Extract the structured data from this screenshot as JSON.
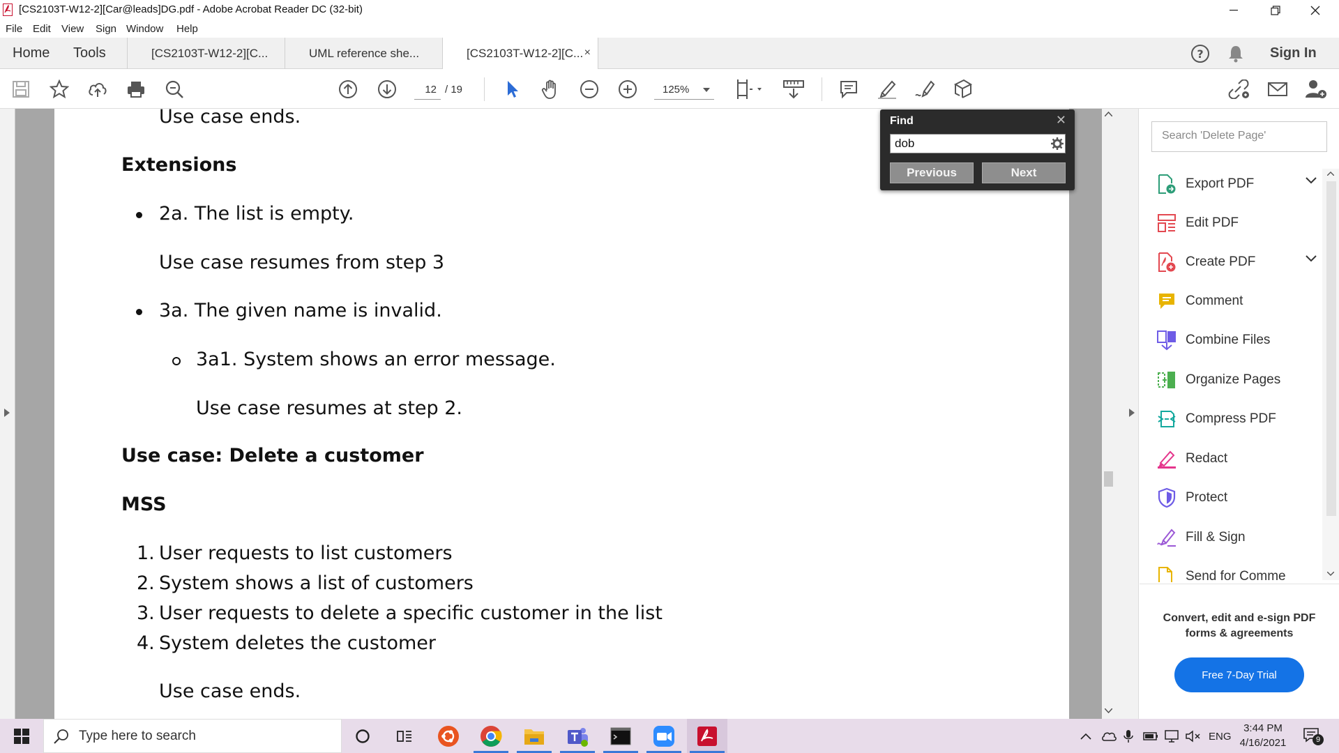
{
  "window": {
    "title": "[CS2103T-W12-2][Car@leads]DG.pdf - Adobe Acrobat Reader DC (32-bit)"
  },
  "menu": [
    "File",
    "Edit",
    "View",
    "Sign",
    "Window",
    "Help"
  ],
  "tabs": {
    "home": "Home",
    "tools": "Tools",
    "documents": [
      {
        "label": "[CS2103T-W12-2][C..."
      },
      {
        "label": "UML reference she..."
      },
      {
        "label": "[CS2103T-W12-2][C..."
      }
    ],
    "close_glyph": "×",
    "sign_in": "Sign In"
  },
  "toolbar": {
    "page_current": "12",
    "page_total": "/ 19",
    "zoom": "125%"
  },
  "document": {
    "lines": {
      "use_case_ends_top": "Use case ends.",
      "extensions_heading": "Extensions",
      "ext_2a": "2a. The list is empty.",
      "resume_step3": "Use case resumes from step 3",
      "ext_3a": "3a. The given name is invalid.",
      "ext_3a1": "3a1. System shows an error message.",
      "resume_step2": "Use case resumes at step 2.",
      "use_case_heading": "Use case: Delete a customer",
      "mss_heading": "MSS",
      "use_case_ends_bottom": "Use case ends."
    },
    "mss_steps": [
      {
        "num": "1.",
        "text": "User requests to list customers"
      },
      {
        "num": "2.",
        "text": "System shows a list of customers"
      },
      {
        "num": "3.",
        "text": "User requests to delete a specific customer in the list"
      },
      {
        "num": "4.",
        "text": "System deletes the customer"
      }
    ]
  },
  "find": {
    "title": "Find",
    "query": "dob",
    "previous": "Previous",
    "next": "Next"
  },
  "right_pane": {
    "search_placeholder": "Search 'Delete Page'",
    "tools": [
      {
        "label": "Export PDF",
        "icon": "export-pdf-icon",
        "color": "#2d9d78",
        "has_chevron": true
      },
      {
        "label": "Edit PDF",
        "icon": "edit-pdf-icon",
        "color": "#e34850",
        "has_chevron": false
      },
      {
        "label": "Create PDF",
        "icon": "create-pdf-icon",
        "color": "#e34850",
        "has_chevron": true
      },
      {
        "label": "Comment",
        "icon": "comment-icon",
        "color": "#e8b400",
        "has_chevron": false
      },
      {
        "label": "Combine Files",
        "icon": "combine-files-icon",
        "color": "#6e5ce6",
        "has_chevron": false
      },
      {
        "label": "Organize Pages",
        "icon": "organize-pages-icon",
        "color": "#4caf50",
        "has_chevron": false
      },
      {
        "label": "Compress PDF",
        "icon": "compress-pdf-icon",
        "color": "#13a89e",
        "has_chevron": false
      },
      {
        "label": "Redact",
        "icon": "redact-icon",
        "color": "#e5358c",
        "has_chevron": false
      },
      {
        "label": "Protect",
        "icon": "protect-icon",
        "color": "#6e5ce6",
        "has_chevron": false
      },
      {
        "label": "Fill & Sign",
        "icon": "fill-sign-icon",
        "color": "#9b59d6",
        "has_chevron": false
      },
      {
        "label": "Send for Comme",
        "icon": "send-for-comment-icon",
        "color": "#e8b400",
        "has_chevron": false
      }
    ],
    "promo_text": "Convert, edit and e-sign PDF forms & agreements",
    "promo_button": "Free 7-Day Trial"
  },
  "taskbar": {
    "search_placeholder": "Type here to search",
    "language": "ENG",
    "time": "3:44 PM",
    "date": "4/16/2021",
    "notification_count": "9"
  }
}
